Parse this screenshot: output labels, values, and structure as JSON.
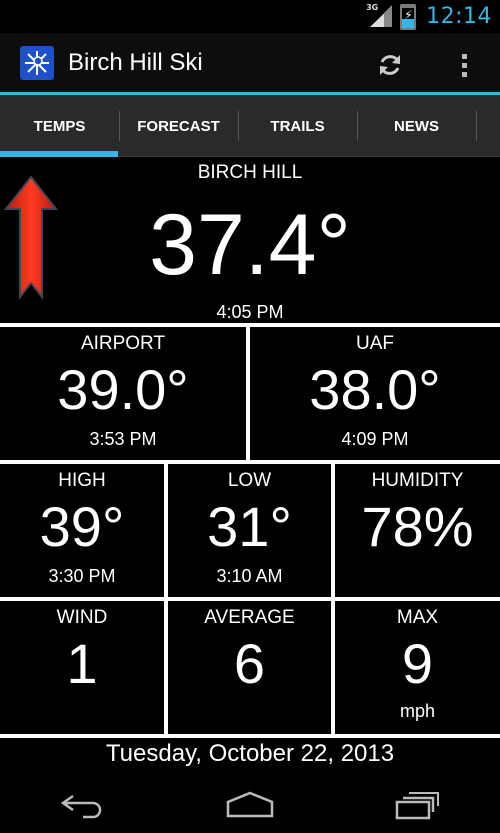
{
  "status": {
    "network": "3G",
    "time": "12:14",
    "accent": "#33b5e5"
  },
  "app": {
    "title": "Birch Hill Ski"
  },
  "tabs": [
    {
      "label": "TEMPS",
      "active": true
    },
    {
      "label": "FORECAST"
    },
    {
      "label": "TRAILS"
    },
    {
      "label": "NEWS"
    }
  ],
  "birch_hill": {
    "label": "BIRCH HILL",
    "temp": "37.4°",
    "time": "4:05 PM",
    "trend": "up-arrow"
  },
  "airport": {
    "label": "AIRPORT",
    "temp": "39.0°",
    "time": "3:53 PM"
  },
  "uaf": {
    "label": "UAF",
    "temp": "38.0°",
    "time": "4:09 PM"
  },
  "high": {
    "label": "HIGH",
    "value": "39°",
    "time": "3:30 PM"
  },
  "low": {
    "label": "LOW",
    "value": "31°",
    "time": "3:10 AM"
  },
  "humidity": {
    "label": "HUMIDITY",
    "value": "78%"
  },
  "wind": {
    "label": "WIND",
    "value": "1"
  },
  "average": {
    "label": "AVERAGE",
    "value": "6"
  },
  "max": {
    "label": "MAX",
    "value": "9",
    "unit": "mph"
  },
  "date": "Tuesday, October 22, 2013",
  "icons": [
    "signal-icon",
    "battery-icon",
    "app-logo-icon",
    "refresh-icon",
    "overflow-menu-icon",
    "trend-up-arrow-icon",
    "back-icon",
    "home-icon",
    "recent-apps-icon"
  ]
}
